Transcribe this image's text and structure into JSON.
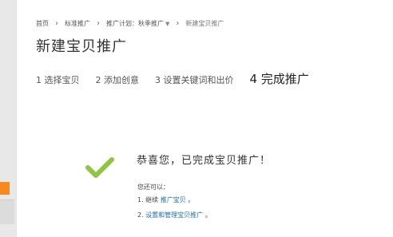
{
  "breadcrumb": {
    "home": "首页",
    "promo": "标准推广",
    "plan_label": "推广计划：秋季推广",
    "current": "新建宝贝推广"
  },
  "page_title": "新建宝贝推广",
  "steps": [
    {
      "label": "1 选择宝贝"
    },
    {
      "label": "2 添加创意"
    },
    {
      "label": "3 设置关键词和出价"
    },
    {
      "label": "4 完成推广"
    }
  ],
  "success": {
    "message": "恭喜您，已完成宝贝推广！",
    "also_label": "您还可以：",
    "option1_prefix": "1. 继续",
    "option1_link": "推广宝贝",
    "option1_suffix": "。",
    "option2_prefix": "2. ",
    "option2_link": "设置和管理宝贝推广",
    "option2_suffix": "。"
  },
  "colors": {
    "check": "#8dc63f",
    "link": "#1f6fb2",
    "accent": "#f58a1f"
  },
  "icons": [
    "chevron-right-icon",
    "caret-down-icon",
    "checkmark-icon"
  ]
}
